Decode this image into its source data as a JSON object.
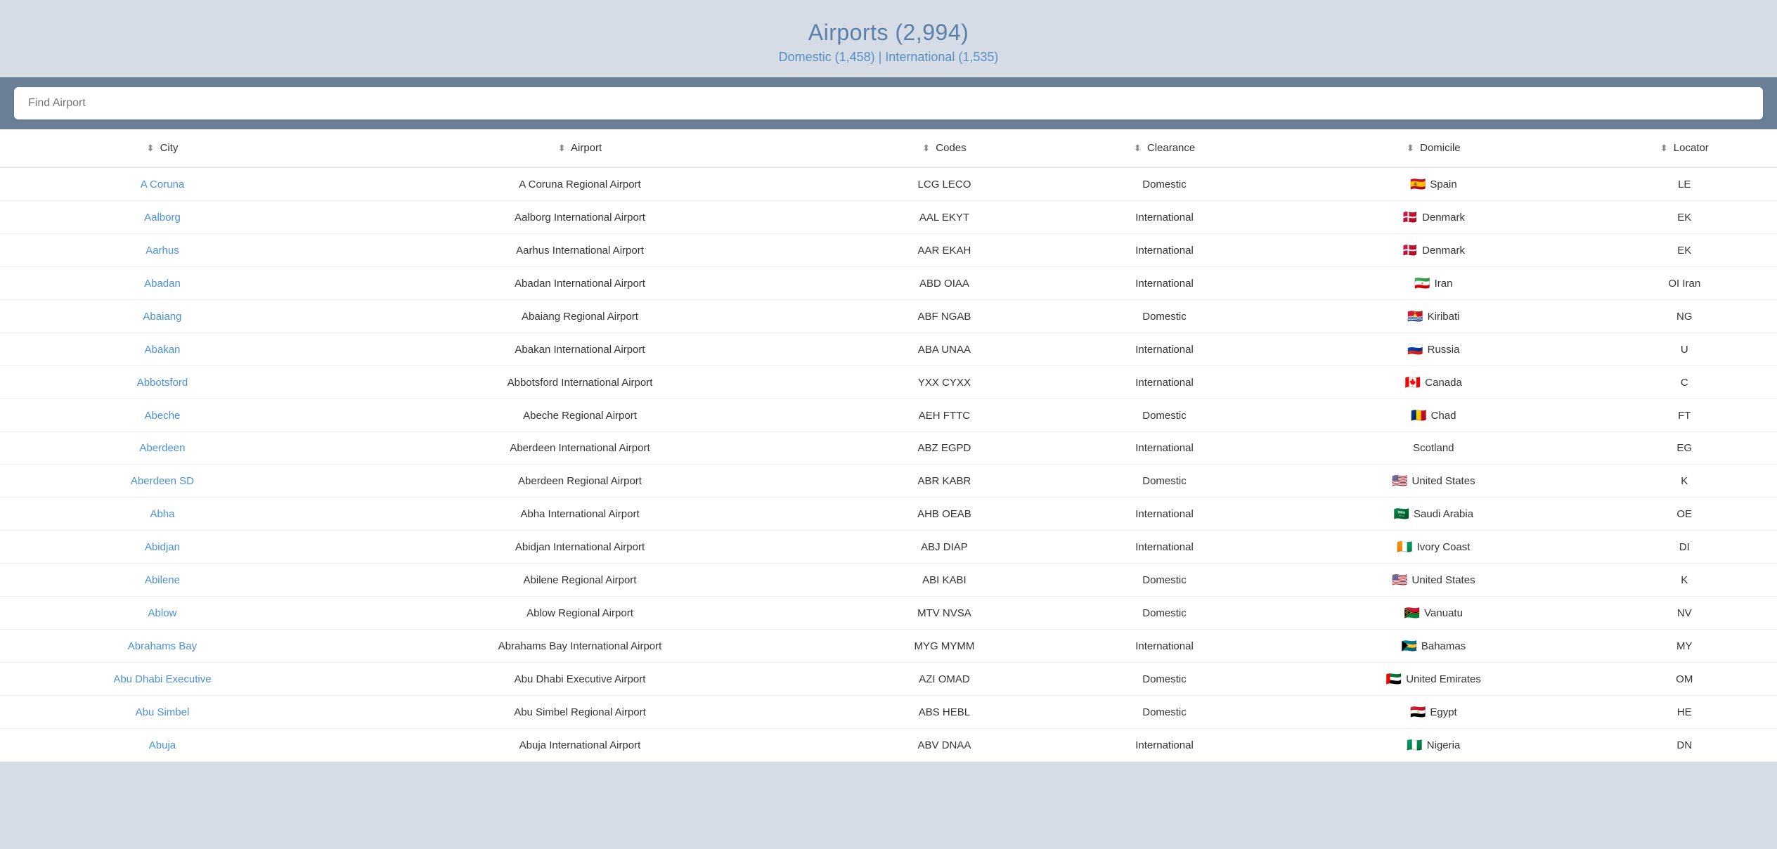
{
  "header": {
    "title": "Airports (2,994)",
    "subtitle": "Domestic (1,458) | International (1,535)"
  },
  "search": {
    "placeholder": "Find Airport"
  },
  "columns": [
    {
      "key": "city",
      "label": "City"
    },
    {
      "key": "airport",
      "label": "Airport"
    },
    {
      "key": "codes",
      "label": "Codes"
    },
    {
      "key": "clearance",
      "label": "Clearance"
    },
    {
      "key": "domicile",
      "label": "Domicile"
    },
    {
      "key": "locator",
      "label": "Locator"
    }
  ],
  "rows": [
    {
      "city": "A Coruna",
      "airport": "A Coruna Regional Airport",
      "codes": "LCG LECO",
      "clearance": "Domestic",
      "domicile": "Spain",
      "flag": "🇪🇸",
      "locator": "LE"
    },
    {
      "city": "Aalborg",
      "airport": "Aalborg International Airport",
      "codes": "AAL EKYT",
      "clearance": "International",
      "domicile": "Denmark",
      "flag": "🇩🇰",
      "locator": "EK"
    },
    {
      "city": "Aarhus",
      "airport": "Aarhus International Airport",
      "codes": "AAR EKAH",
      "clearance": "International",
      "domicile": "Denmark",
      "flag": "🇩🇰",
      "locator": "EK"
    },
    {
      "city": "Abadan",
      "airport": "Abadan International Airport",
      "codes": "ABD OIAA",
      "clearance": "International",
      "domicile": "Iran",
      "flag": "🇮🇷",
      "locator": "OI Iran"
    },
    {
      "city": "Abaiang",
      "airport": "Abaiang Regional Airport",
      "codes": "ABF NGAB",
      "clearance": "Domestic",
      "domicile": "Kiribati",
      "flag": "🇰🇮",
      "locator": "NG"
    },
    {
      "city": "Abakan",
      "airport": "Abakan International Airport",
      "codes": "ABA UNAA",
      "clearance": "International",
      "domicile": "Russia",
      "flag": "🇷🇺",
      "locator": "U"
    },
    {
      "city": "Abbotsford",
      "airport": "Abbotsford International Airport",
      "codes": "YXX CYXX",
      "clearance": "International",
      "domicile": "Canada",
      "flag": "🇨🇦",
      "locator": "C"
    },
    {
      "city": "Abeche",
      "airport": "Abeche Regional Airport",
      "codes": "AEH FTTC",
      "clearance": "Domestic",
      "domicile": "Chad",
      "flag": "🇹🇩",
      "locator": "FT"
    },
    {
      "city": "Aberdeen",
      "airport": "Aberdeen International Airport",
      "codes": "ABZ EGPD",
      "clearance": "International",
      "domicile": "Scotland",
      "flag": "",
      "locator": "EG"
    },
    {
      "city": "Aberdeen SD",
      "airport": "Aberdeen Regional Airport",
      "codes": "ABR KABR",
      "clearance": "Domestic",
      "domicile": "United States",
      "flag": "🇺🇸",
      "locator": "K"
    },
    {
      "city": "Abha",
      "airport": "Abha International Airport",
      "codes": "AHB OEAB",
      "clearance": "International",
      "domicile": "Saudi Arabia",
      "flag": "🇸🇦",
      "locator": "OE"
    },
    {
      "city": "Abidjan",
      "airport": "Abidjan International Airport",
      "codes": "ABJ DIAP",
      "clearance": "International",
      "domicile": "Ivory Coast",
      "flag": "🇨🇮",
      "locator": "DI"
    },
    {
      "city": "Abilene",
      "airport": "Abilene Regional Airport",
      "codes": "ABI KABI",
      "clearance": "Domestic",
      "domicile": "United States",
      "flag": "🇺🇸",
      "locator": "K"
    },
    {
      "city": "Ablow",
      "airport": "Ablow Regional Airport",
      "codes": "MTV NVSA",
      "clearance": "Domestic",
      "domicile": "Vanuatu",
      "flag": "🇻🇺",
      "locator": "NV"
    },
    {
      "city": "Abrahams Bay",
      "airport": "Abrahams Bay International Airport",
      "codes": "MYG MYMM",
      "clearance": "International",
      "domicile": "Bahamas",
      "flag": "🇧🇸",
      "locator": "MY"
    },
    {
      "city": "Abu Dhabi Executive",
      "airport": "Abu Dhabi Executive Airport",
      "codes": "AZI OMAD",
      "clearance": "Domestic",
      "domicile": "United Emirates",
      "flag": "🇦🇪",
      "locator": "OM"
    },
    {
      "city": "Abu Simbel",
      "airport": "Abu Simbel Regional Airport",
      "codes": "ABS HEBL",
      "clearance": "Domestic",
      "domicile": "Egypt",
      "flag": "🇪🇬",
      "locator": "HE"
    },
    {
      "city": "Abuja",
      "airport": "Abuja International Airport",
      "codes": "ABV DNAA",
      "clearance": "International",
      "domicile": "Nigeria",
      "flag": "🇳🇬",
      "locator": "DN"
    }
  ]
}
